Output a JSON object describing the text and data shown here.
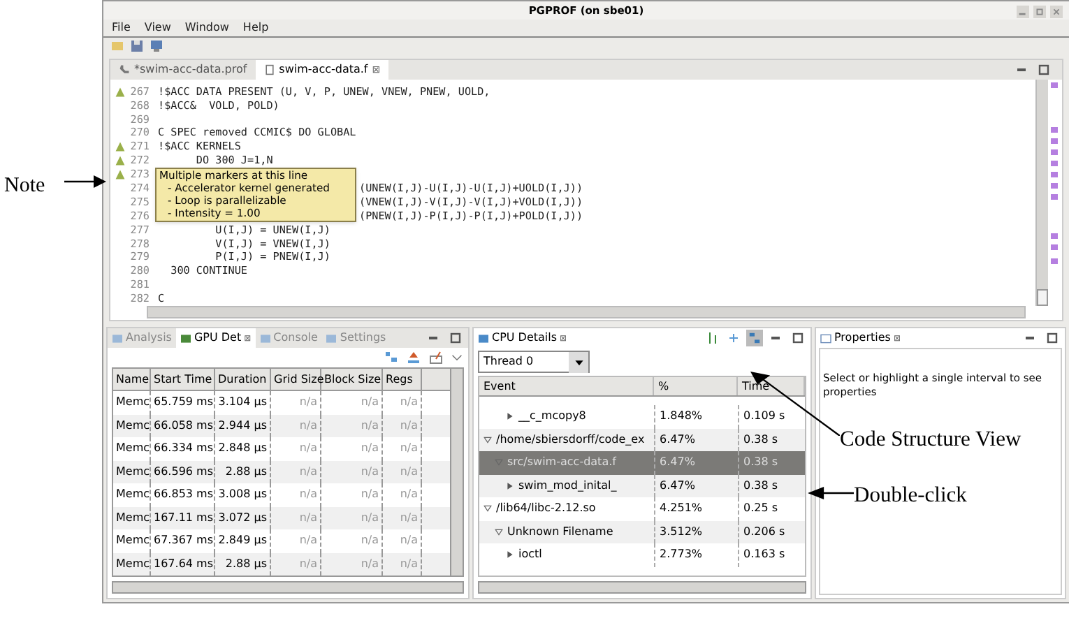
{
  "window": {
    "title": "PGPROF  (on sbe01)"
  },
  "menu": [
    "File",
    "View",
    "Window",
    "Help"
  ],
  "editor_tabs": [
    {
      "label": "*swim-acc-data.prof",
      "selected": false,
      "kind": "profile"
    },
    {
      "label": "swim-acc-data.f",
      "selected": true,
      "kind": "source"
    }
  ],
  "editor_tab_close": "⊠",
  "code_lines": [
    {
      "number": "267",
      "code": "!$ACC DATA PRESENT (U, V, P, UNEW, VNEW, PNEW, UOLD,",
      "marker": true,
      "kind": "plain"
    },
    {
      "number": "268",
      "code": "!$ACC&  VOLD, POLD)",
      "marker": false,
      "kind": "plain"
    },
    {
      "number": "269",
      "marker": false,
      "kind": "plain"
    },
    {
      "number": "270",
      "code": "C SPEC removed CCMIC$ DO GLOBAL",
      "marker": false,
      "kind": "plain"
    },
    {
      "number": "271",
      "code": "!$ACC KERNELS",
      "marker": true,
      "kind": "plain"
    },
    {
      "number": "272",
      "code": "      DO 300 J=1,N",
      "marker": true,
      "kind": "plain"
    },
    {
      "number": "273",
      "marker": true,
      "kind": "plain"
    },
    {
      "number": "274",
      "code": "(UNEW(I,J)-U(I,J)-U(I,J)+UOLD(I,J))",
      "marker": false,
      "kind": "covered"
    },
    {
      "number": "275",
      "code": "(VNEW(I,J)-V(I,J)-V(I,J)+VOLD(I,J))",
      "marker": false,
      "kind": "covered"
    },
    {
      "number": "276",
      "code": "(PNEW(I,J)-P(I,J)-P(I,J)+POLD(I,J))",
      "marker": false,
      "kind": "covered"
    },
    {
      "number": "277",
      "code": "         U(I,J) = UNEW(I,J)",
      "marker": false,
      "kind": "plain"
    },
    {
      "number": "278",
      "code": "         V(I,J) = VNEW(I,J)",
      "marker": false,
      "kind": "plain"
    },
    {
      "number": "279",
      "code": "         P(I,J) = PNEW(I,J)",
      "marker": false,
      "kind": "plain"
    },
    {
      "number": "280",
      "code": "  300 CONTINUE",
      "marker": false,
      "kind": "plain"
    },
    {
      "number": "281",
      "marker": false,
      "kind": "plain"
    },
    {
      "number": "282",
      "code": "C",
      "marker": false,
      "kind": "plain"
    }
  ],
  "tooltip": {
    "title": "Multiple markers at this line",
    "items": [
      "- Accelerator kernel generated",
      "- Loop is parallelizable",
      "- Intensity = 1.00"
    ]
  },
  "left_panel": {
    "tabs": [
      {
        "label": "Analysis",
        "selected": false
      },
      {
        "label": "GPU Det",
        "selected": true
      },
      {
        "label": "Console",
        "selected": false
      },
      {
        "label": "Settings",
        "selected": false
      }
    ],
    "close": "⊠",
    "table": {
      "columns": [
        "Name",
        "Start Time",
        "Duration",
        "Grid Size",
        "Block Size",
        "Regs"
      ],
      "rows": [
        [
          "Memc",
          "65.759 ms",
          "3.104 µs",
          "n/a",
          "n/a",
          "n/a"
        ],
        [
          "Memc",
          "66.058 ms",
          "2.944 µs",
          "n/a",
          "n/a",
          "n/a"
        ],
        [
          "Memc",
          "66.334 ms",
          "2.848 µs",
          "n/a",
          "n/a",
          "n/a"
        ],
        [
          "Memc",
          "66.596 ms",
          "2.88 µs",
          "n/a",
          "n/a",
          "n/a"
        ],
        [
          "Memc",
          "66.853 ms",
          "3.008 µs",
          "n/a",
          "n/a",
          "n/a"
        ],
        [
          "Memc",
          "167.11 ms",
          "3.072 µs",
          "n/a",
          "n/a",
          "n/a"
        ],
        [
          "Memc",
          "67.367 ms",
          "2.849 µs",
          "n/a",
          "n/a",
          "n/a"
        ],
        [
          "Memc",
          "167.64 ms",
          "2.88 µs",
          "n/a",
          "n/a",
          "n/a"
        ]
      ]
    }
  },
  "cpu_panel": {
    "title": "CPU Details",
    "close": "⊠",
    "thread": "Thread 0",
    "columns": [
      "Event",
      "%",
      "Time"
    ],
    "tree": [
      {
        "children": [
          {
            "children": [
              {
                "label": "__c_mcopy8",
                "percent": "1.848%",
                "time": "0.109 s",
                "expanded": false,
                "selected": false
              }
            ]
          }
        ]
      },
      {
        "label": "/home/sbiersdorff/code_ex",
        "percent": "6.47%",
        "time": "0.38 s",
        "expanded": true,
        "selected": false,
        "children": [
          {
            "label": "src/swim-acc-data.f",
            "percent": "6.47%",
            "time": "0.38 s",
            "expanded": true,
            "selected": true,
            "children": [
              {
                "label": "swim_mod_inital_",
                "percent": "6.47%",
                "time": "0.38 s",
                "expanded": false,
                "selected": false
              }
            ]
          }
        ]
      },
      {
        "label": "/lib64/libc-2.12.so",
        "percent": "4.251%",
        "time": "0.25 s",
        "expanded": true,
        "selected": false,
        "children": [
          {
            "label": "Unknown Filename",
            "percent": "3.512%",
            "time": "0.206 s",
            "expanded": true,
            "selected": false,
            "children": [
              {
                "label": "ioctl",
                "percent": "2.773%",
                "time": "0.163 s",
                "expanded": false,
                "selected": false
              }
            ]
          }
        ]
      }
    ]
  },
  "properties_panel": {
    "title": "Properties",
    "close": "⊠",
    "message": "Select or highlight a single interval to see properties"
  },
  "annotations": [
    {
      "text": "Note",
      "kind": "note"
    },
    {
      "text": "Code Structure View",
      "kind": "structure"
    },
    {
      "text": "Double-click",
      "kind": "dblclick"
    }
  ]
}
